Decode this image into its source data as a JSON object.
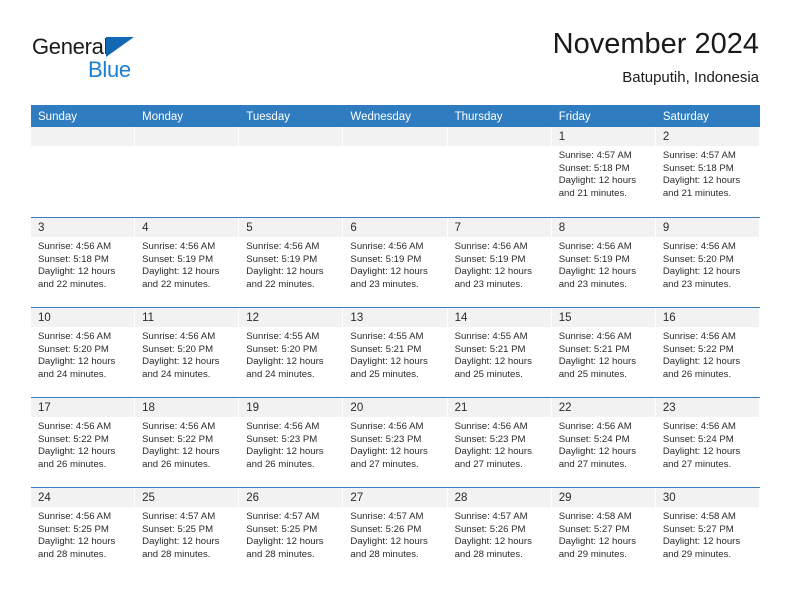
{
  "brand": {
    "name_top": "General",
    "name_bottom": "Blue",
    "accent_color": "#1268b3",
    "accent_light": "#1b7fd4"
  },
  "header": {
    "title": "November 2024",
    "subtitle": "Batuputih, Indonesia"
  },
  "theme": {
    "header_row_bg": "#2f7cc0",
    "day_head_bg": "#f2f2f2",
    "row_border": "#3b7fbf",
    "text": "#2b2b2b"
  },
  "weekdays": [
    "Sunday",
    "Monday",
    "Tuesday",
    "Wednesday",
    "Thursday",
    "Friday",
    "Saturday"
  ],
  "weeks": [
    [
      {
        "day": "",
        "lines": []
      },
      {
        "day": "",
        "lines": []
      },
      {
        "day": "",
        "lines": []
      },
      {
        "day": "",
        "lines": []
      },
      {
        "day": "",
        "lines": []
      },
      {
        "day": "1",
        "lines": [
          "Sunrise: 4:57 AM",
          "Sunset: 5:18 PM",
          "Daylight: 12 hours",
          "and 21 minutes."
        ]
      },
      {
        "day": "2",
        "lines": [
          "Sunrise: 4:57 AM",
          "Sunset: 5:18 PM",
          "Daylight: 12 hours",
          "and 21 minutes."
        ]
      }
    ],
    [
      {
        "day": "3",
        "lines": [
          "Sunrise: 4:56 AM",
          "Sunset: 5:18 PM",
          "Daylight: 12 hours",
          "and 22 minutes."
        ]
      },
      {
        "day": "4",
        "lines": [
          "Sunrise: 4:56 AM",
          "Sunset: 5:19 PM",
          "Daylight: 12 hours",
          "and 22 minutes."
        ]
      },
      {
        "day": "5",
        "lines": [
          "Sunrise: 4:56 AM",
          "Sunset: 5:19 PM",
          "Daylight: 12 hours",
          "and 22 minutes."
        ]
      },
      {
        "day": "6",
        "lines": [
          "Sunrise: 4:56 AM",
          "Sunset: 5:19 PM",
          "Daylight: 12 hours",
          "and 23 minutes."
        ]
      },
      {
        "day": "7",
        "lines": [
          "Sunrise: 4:56 AM",
          "Sunset: 5:19 PM",
          "Daylight: 12 hours",
          "and 23 minutes."
        ]
      },
      {
        "day": "8",
        "lines": [
          "Sunrise: 4:56 AM",
          "Sunset: 5:19 PM",
          "Daylight: 12 hours",
          "and 23 minutes."
        ]
      },
      {
        "day": "9",
        "lines": [
          "Sunrise: 4:56 AM",
          "Sunset: 5:20 PM",
          "Daylight: 12 hours",
          "and 23 minutes."
        ]
      }
    ],
    [
      {
        "day": "10",
        "lines": [
          "Sunrise: 4:56 AM",
          "Sunset: 5:20 PM",
          "Daylight: 12 hours",
          "and 24 minutes."
        ]
      },
      {
        "day": "11",
        "lines": [
          "Sunrise: 4:56 AM",
          "Sunset: 5:20 PM",
          "Daylight: 12 hours",
          "and 24 minutes."
        ]
      },
      {
        "day": "12",
        "lines": [
          "Sunrise: 4:55 AM",
          "Sunset: 5:20 PM",
          "Daylight: 12 hours",
          "and 24 minutes."
        ]
      },
      {
        "day": "13",
        "lines": [
          "Sunrise: 4:55 AM",
          "Sunset: 5:21 PM",
          "Daylight: 12 hours",
          "and 25 minutes."
        ]
      },
      {
        "day": "14",
        "lines": [
          "Sunrise: 4:55 AM",
          "Sunset: 5:21 PM",
          "Daylight: 12 hours",
          "and 25 minutes."
        ]
      },
      {
        "day": "15",
        "lines": [
          "Sunrise: 4:56 AM",
          "Sunset: 5:21 PM",
          "Daylight: 12 hours",
          "and 25 minutes."
        ]
      },
      {
        "day": "16",
        "lines": [
          "Sunrise: 4:56 AM",
          "Sunset: 5:22 PM",
          "Daylight: 12 hours",
          "and 26 minutes."
        ]
      }
    ],
    [
      {
        "day": "17",
        "lines": [
          "Sunrise: 4:56 AM",
          "Sunset: 5:22 PM",
          "Daylight: 12 hours",
          "and 26 minutes."
        ]
      },
      {
        "day": "18",
        "lines": [
          "Sunrise: 4:56 AM",
          "Sunset: 5:22 PM",
          "Daylight: 12 hours",
          "and 26 minutes."
        ]
      },
      {
        "day": "19",
        "lines": [
          "Sunrise: 4:56 AM",
          "Sunset: 5:23 PM",
          "Daylight: 12 hours",
          "and 26 minutes."
        ]
      },
      {
        "day": "20",
        "lines": [
          "Sunrise: 4:56 AM",
          "Sunset: 5:23 PM",
          "Daylight: 12 hours",
          "and 27 minutes."
        ]
      },
      {
        "day": "21",
        "lines": [
          "Sunrise: 4:56 AM",
          "Sunset: 5:23 PM",
          "Daylight: 12 hours",
          "and 27 minutes."
        ]
      },
      {
        "day": "22",
        "lines": [
          "Sunrise: 4:56 AM",
          "Sunset: 5:24 PM",
          "Daylight: 12 hours",
          "and 27 minutes."
        ]
      },
      {
        "day": "23",
        "lines": [
          "Sunrise: 4:56 AM",
          "Sunset: 5:24 PM",
          "Daylight: 12 hours",
          "and 27 minutes."
        ]
      }
    ],
    [
      {
        "day": "24",
        "lines": [
          "Sunrise: 4:56 AM",
          "Sunset: 5:25 PM",
          "Daylight: 12 hours",
          "and 28 minutes."
        ]
      },
      {
        "day": "25",
        "lines": [
          "Sunrise: 4:57 AM",
          "Sunset: 5:25 PM",
          "Daylight: 12 hours",
          "and 28 minutes."
        ]
      },
      {
        "day": "26",
        "lines": [
          "Sunrise: 4:57 AM",
          "Sunset: 5:25 PM",
          "Daylight: 12 hours",
          "and 28 minutes."
        ]
      },
      {
        "day": "27",
        "lines": [
          "Sunrise: 4:57 AM",
          "Sunset: 5:26 PM",
          "Daylight: 12 hours",
          "and 28 minutes."
        ]
      },
      {
        "day": "28",
        "lines": [
          "Sunrise: 4:57 AM",
          "Sunset: 5:26 PM",
          "Daylight: 12 hours",
          "and 28 minutes."
        ]
      },
      {
        "day": "29",
        "lines": [
          "Sunrise: 4:58 AM",
          "Sunset: 5:27 PM",
          "Daylight: 12 hours",
          "and 29 minutes."
        ]
      },
      {
        "day": "30",
        "lines": [
          "Sunrise: 4:58 AM",
          "Sunset: 5:27 PM",
          "Daylight: 12 hours",
          "and 29 minutes."
        ]
      }
    ]
  ]
}
